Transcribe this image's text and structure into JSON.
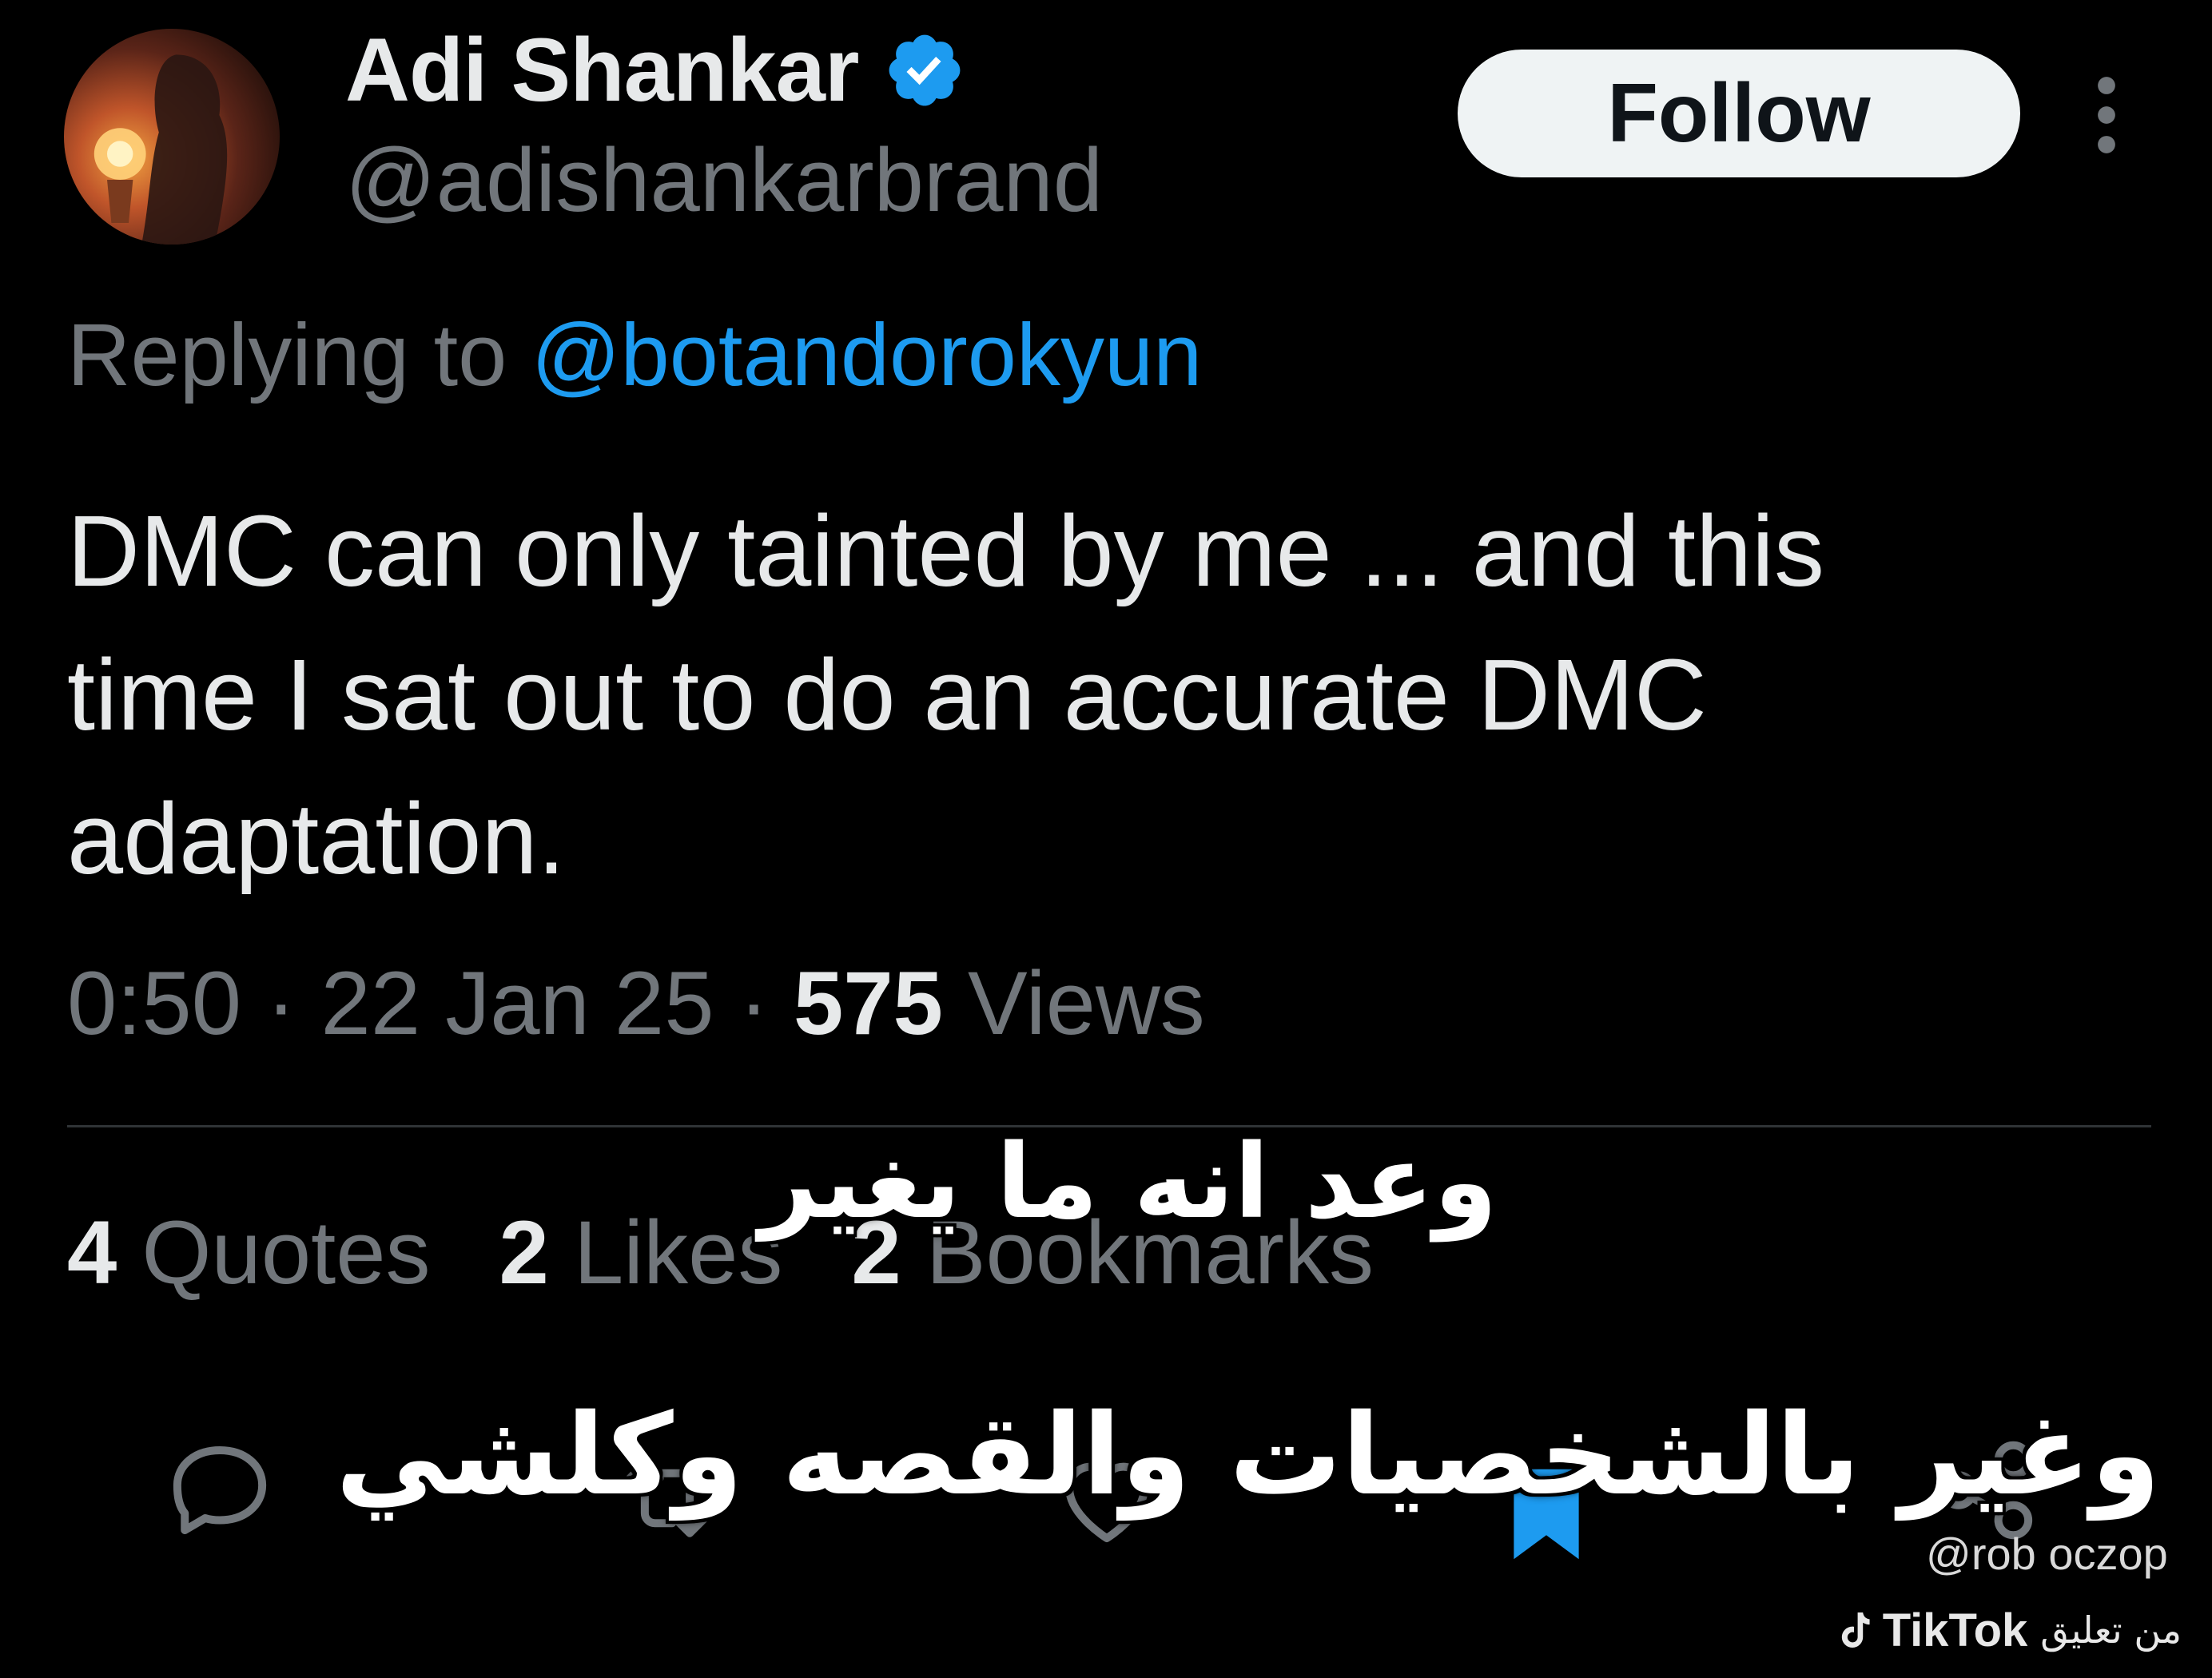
{
  "colors": {
    "background": "#000000",
    "primary_text": "#e7e9ea",
    "secondary_text": "#71767b",
    "accent_link": "#1d9bf0",
    "follow_button_bg": "#eff3f4",
    "divider": "#2f3336"
  },
  "author": {
    "name": "Adi Shankar",
    "handle": "@adishankarbrand",
    "verified": true,
    "avatar_icon": "avatar-image"
  },
  "header": {
    "follow_label": "Follow",
    "more_icon": "more-vertical-icon"
  },
  "reply": {
    "prefix": "Replying to",
    "handle": "@botandorokyun"
  },
  "tweet": {
    "lines": [
      "DMC can only tainted by me ... and this",
      "time I sat out to do an accurate DMC",
      "adaptation."
    ]
  },
  "meta": {
    "time": "0:50",
    "separator": "·",
    "date": "22 Jan 25",
    "views_count": "575",
    "views_label": "Views"
  },
  "stats": {
    "quotes_count": "4",
    "quotes_label": "Quotes",
    "likes_count": "2",
    "likes_label": "Likes",
    "bookmarks_count": "2",
    "bookmarks_label": "Bookmarks"
  },
  "actions": [
    {
      "icon": "reply-icon"
    },
    {
      "icon": "retweet-icon"
    },
    {
      "icon": "like-icon"
    },
    {
      "icon": "bookmark-icon"
    },
    {
      "icon": "share-icon"
    }
  ],
  "overlay": {
    "subtitle_1": "وعد انه ما يغير",
    "subtitle_2": "وغير بالشخصيات والقصه وكلشي"
  },
  "watermark": {
    "handle": "@rob oczop",
    "brand": "TikTok",
    "caption": "من تعليق"
  }
}
